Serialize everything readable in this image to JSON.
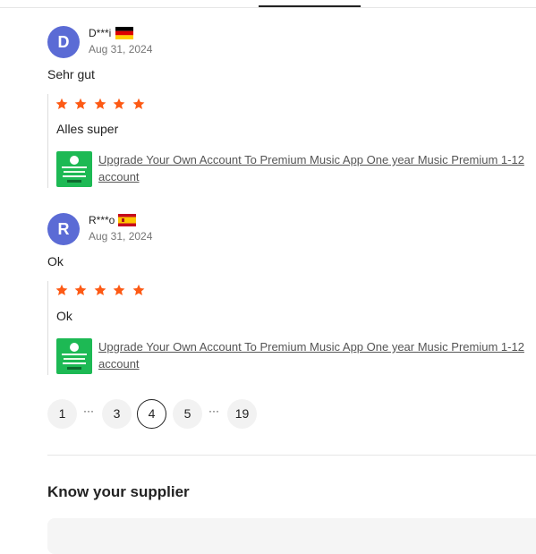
{
  "reviews": [
    {
      "avatar_letter": "D",
      "name": "D***i",
      "flag": "germany-flag",
      "date": "Aug 31, 2024",
      "text": "Sehr gut",
      "rating": 5,
      "quote": "Alles super",
      "product_title": "Upgrade Your Own Account To Premium Music App One year Music Premium 1-12",
      "product_title_line2": "account"
    },
    {
      "avatar_letter": "R",
      "name": "R***o",
      "flag": "spain-flag",
      "date": "Aug 31, 2024",
      "text": "Ok",
      "rating": 5,
      "quote": "Ok",
      "product_title": "Upgrade Your Own Account To Premium Music App One year Music Premium 1-12",
      "product_title_line2": "account"
    }
  ],
  "pagination": {
    "pages": [
      "1",
      "3",
      "4",
      "5",
      "19"
    ],
    "ellipsis": "···",
    "current": "4"
  },
  "supplier_section": {
    "title": "Know your supplier"
  },
  "colors": {
    "avatar": "#5b6bd5",
    "star": "#fd5a15",
    "thumb": "#1db954"
  }
}
